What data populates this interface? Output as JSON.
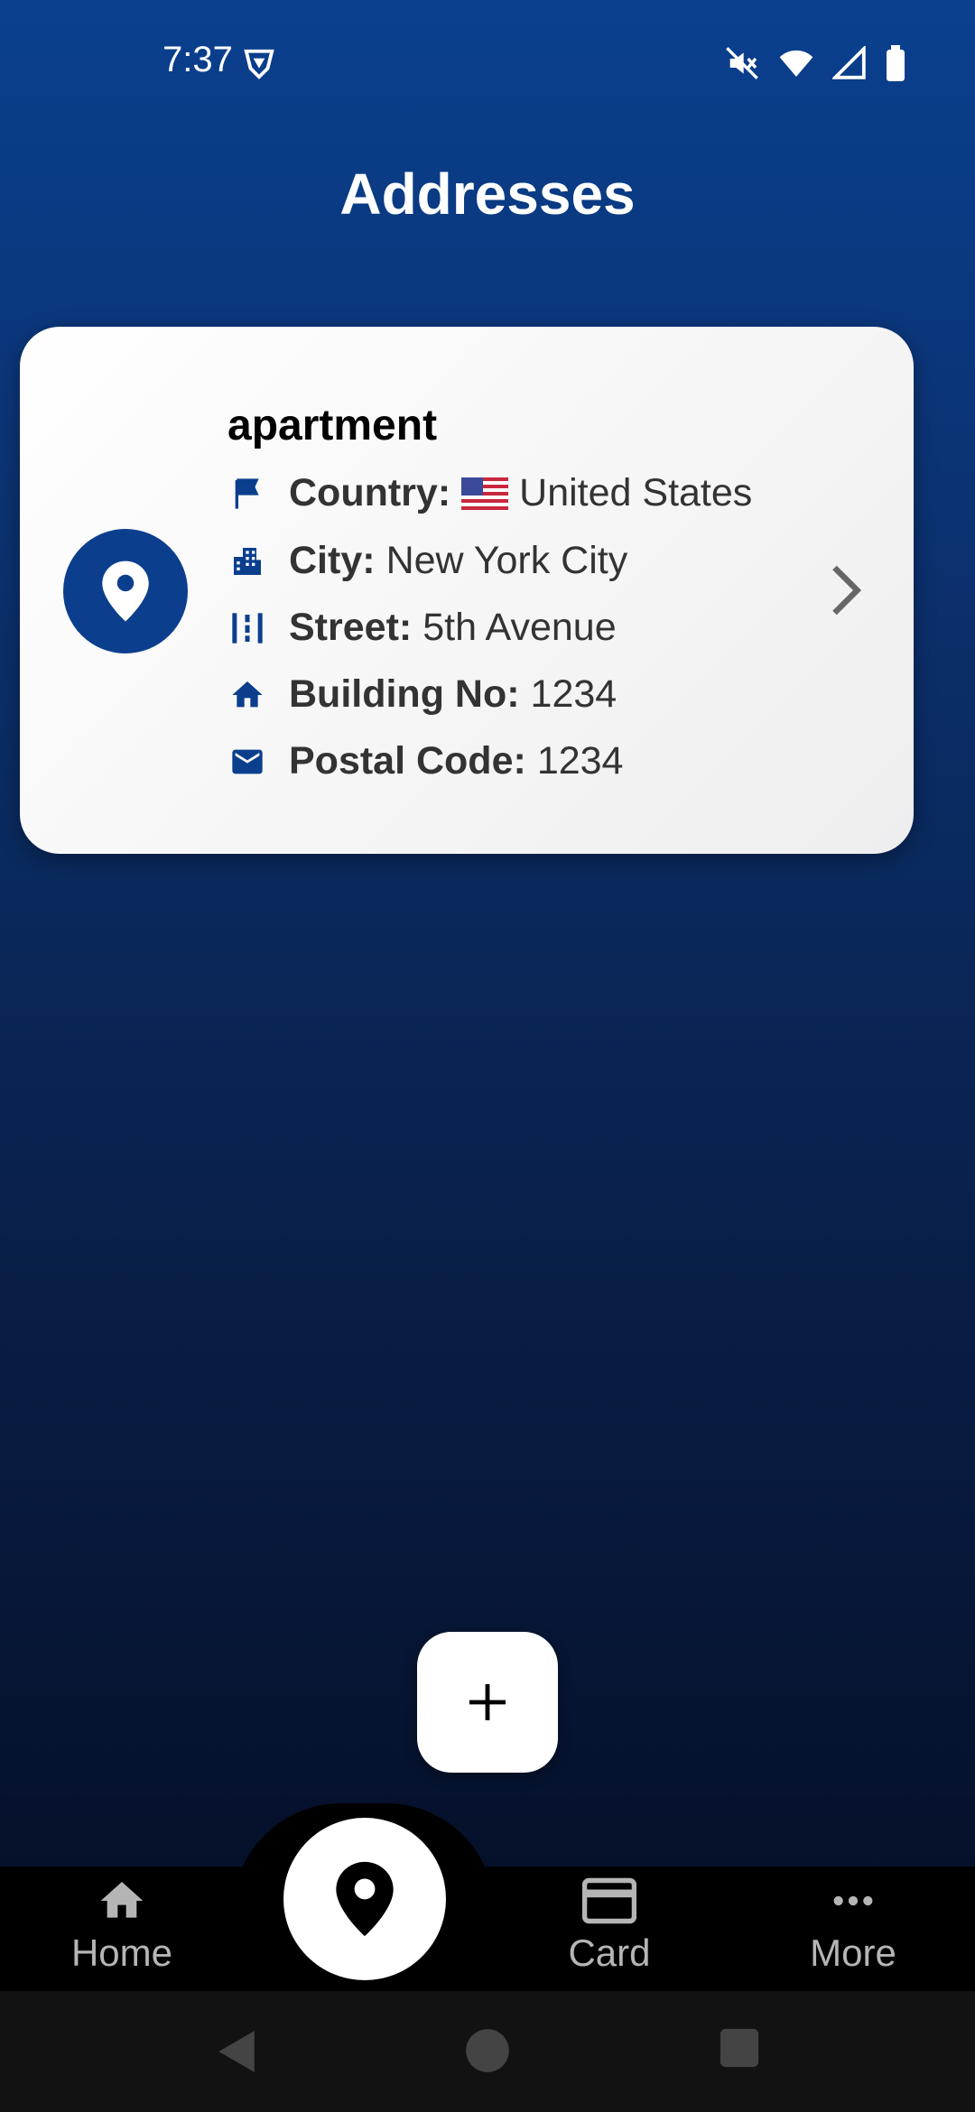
{
  "status_bar": {
    "time": "7:37"
  },
  "header": {
    "title": "Addresses"
  },
  "address_card": {
    "title": "apartment",
    "fields": [
      {
        "icon": "flag-icon",
        "label": "Country:",
        "flag": "us-flag",
        "value": "United States"
      },
      {
        "icon": "city-icon",
        "label": "City:",
        "value": "New York City"
      },
      {
        "icon": "street-icon",
        "label": "Street:",
        "value": "5th Avenue"
      },
      {
        "icon": "home-icon",
        "label": "Building No:",
        "value": "1234"
      },
      {
        "icon": "mail-icon",
        "label": "Postal Code:",
        "value": "1234"
      }
    ]
  },
  "fab": {
    "icon": "plus-icon"
  },
  "bottom_nav": {
    "items": [
      {
        "label": "Home",
        "icon": "home-icon"
      },
      {
        "label": "",
        "icon": "location-pin-icon",
        "active": true
      },
      {
        "label": "Card",
        "icon": "card-icon"
      },
      {
        "label": "More",
        "icon": "more-icon"
      }
    ]
  },
  "colors": {
    "accent": "#0b3f8d",
    "background_top": "#0a408f",
    "background_bottom": "#040b1e"
  }
}
